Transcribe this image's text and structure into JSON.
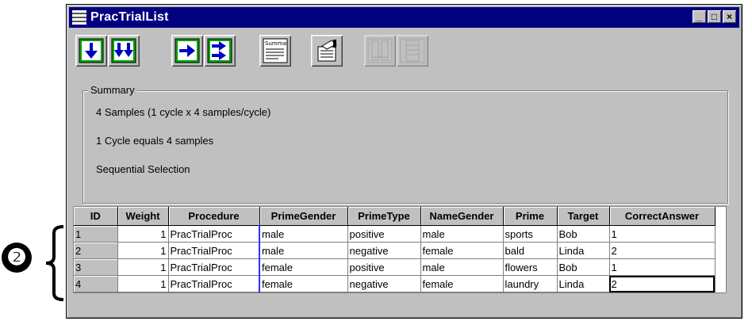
{
  "window": {
    "title": "PracTrialList"
  },
  "titlebar_buttons": {
    "minimize": "_",
    "maximize": "□",
    "close": "×"
  },
  "toolbar": {
    "tools": [
      {
        "icon": "add-level-icon",
        "enabled": true
      },
      {
        "icon": "add-multiple-levels-icon",
        "enabled": true
      },
      {
        "icon": "add-attribute-icon",
        "enabled": true
      },
      {
        "icon": "add-multiple-attributes-icon",
        "enabled": true
      },
      {
        "icon": "summary-icon",
        "label": "Summary",
        "enabled": true
      },
      {
        "icon": "properties-icon",
        "enabled": true
      },
      {
        "icon": "remove-levels-icon",
        "enabled": false
      },
      {
        "icon": "remove-attributes-icon",
        "enabled": false
      }
    ]
  },
  "summary": {
    "legend": "Summary",
    "lines": [
      "4 Samples (1 cycle x 4 samples/cycle)",
      "1 Cycle equals 4 samples",
      "Sequential Selection"
    ]
  },
  "annotation": {
    "marker": "❷"
  },
  "grid": {
    "columns": [
      "ID",
      "Weight",
      "Procedure",
      "PrimeGender",
      "PrimeType",
      "NameGender",
      "Prime",
      "Target",
      "CorrectAnswer"
    ],
    "rows": [
      [
        "1",
        "1",
        "PracTrialProc",
        "male",
        "positive",
        "male",
        "sports",
        "Bob",
        "1"
      ],
      [
        "2",
        "1",
        "PracTrialProc",
        "male",
        "negative",
        "female",
        "bald",
        "Linda",
        "2"
      ],
      [
        "3",
        "1",
        "PracTrialProc",
        "female",
        "positive",
        "male",
        "flowers",
        "Bob",
        "1"
      ],
      [
        "4",
        "1",
        "PracTrialProc",
        "female",
        "negative",
        "female",
        "laundry",
        "Linda",
        "2"
      ]
    ]
  },
  "colors": {
    "titlebar": "#000080",
    "face": "#c0c0c0",
    "grid_bg": "#ffffff",
    "accent_line": "#3030ff",
    "tool_green": "#00a000",
    "tool_blue": "#0000c0"
  }
}
